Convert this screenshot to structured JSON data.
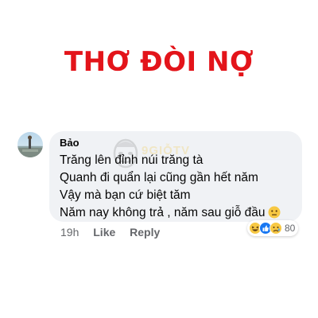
{
  "headline": "THƠ ĐÒI NỢ",
  "comment": {
    "author": "Bảo",
    "lines": [
      "Trăng lên đỉnh núi trăng tà",
      "Quanh đi quẩn lại cũng gần hết năm",
      "Vậy mà bạn cứ biệt tăm",
      "Năm nay không trả , năm sau giỗ đầu"
    ],
    "trailing_emoji": "neutral-face-icon",
    "timestamp": "19h",
    "like_label": "Like",
    "reply_label": "Reply",
    "reactions": [
      "haha-icon",
      "like-icon",
      "sad-icon"
    ],
    "reaction_count": "80"
  },
  "watermark": "9GIỖTV",
  "colors": {
    "headline": "#e3141a",
    "bubble": "#f0f2f5",
    "meta_text": "#65676b",
    "like_blue": "#1877f2",
    "emoji_yellow": "#f7c843"
  }
}
